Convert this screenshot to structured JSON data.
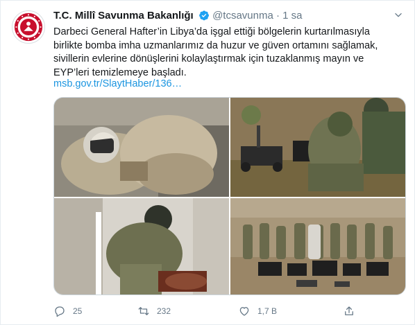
{
  "tweet": {
    "author_name": "T.C. Millî Savunma Bakanlığı",
    "handle": "@tcsavunma",
    "separator": "·",
    "time": "1 sa",
    "text_lines": [
      "Darbeci General Hafter’in Libya’da işgal ettiği bölgelerin kurtarılmasıyla",
      "birlikte bomba imha uzmanlarımız da huzur ve güven ortamını sağlamak,",
      "sivillerin evlerine dönüşlerini kolaylaştırmak için tuzaklanmış mayın ve",
      "EYP’leri temizlemeye başladı."
    ],
    "link": "msb.gov.tr/SlaytHaber/136…",
    "stats": {
      "replies": "25",
      "retweets": "232",
      "likes": "1,7 B"
    }
  },
  "icons": {
    "verified": "verified-badge-icon",
    "caret": "chevron-down-icon",
    "reply": "reply-icon",
    "retweet": "retweet-icon",
    "like": "heart-icon",
    "share": "share-icon"
  },
  "colors": {
    "text": "#14171a",
    "muted": "#657786",
    "link": "#1b95e0",
    "verified": "#1da1f2",
    "emblem_red": "#c8102e",
    "border": "#e6ecf0"
  }
}
